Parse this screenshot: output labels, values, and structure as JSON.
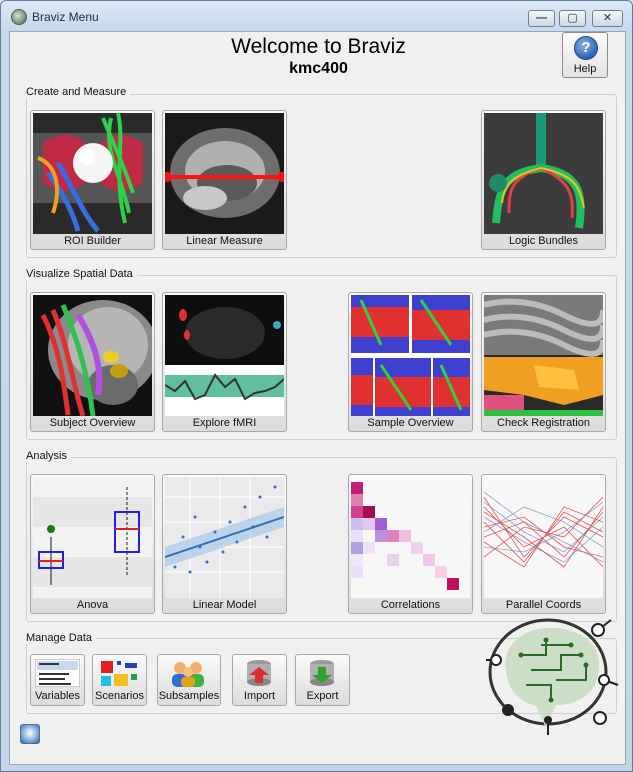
{
  "window": {
    "title": "Braviz Menu",
    "min_glyph": "—",
    "max_glyph": "▢",
    "close_glyph": "✕"
  },
  "header": {
    "welcome": "Welcome to Braviz",
    "user": "kmc400"
  },
  "help": {
    "icon_glyph": "?",
    "label": "Help"
  },
  "sections": {
    "create": {
      "title": "Create and Measure",
      "tiles": {
        "roi": "ROI Builder",
        "linear": "Linear Measure",
        "logic": "Logic Bundles"
      }
    },
    "visualize": {
      "title": "Visualize Spatial Data",
      "tiles": {
        "subject": "Subject Overview",
        "fmri": "Explore fMRI",
        "sample": "Sample Overview",
        "registration": "Check Registration"
      }
    },
    "analysis": {
      "title": "Analysis",
      "tiles": {
        "anova": "Anova",
        "linear_model": "Linear Model",
        "correlations": "Correlations",
        "parallel": "Parallel Coords"
      }
    },
    "manage": {
      "title": "Manage Data",
      "buttons": {
        "variables": "Variables",
        "scenarios": "Scenarios",
        "subsamples": "Subsamples",
        "import": "Import",
        "export": "Export"
      }
    }
  },
  "colors": {
    "title_bar": "#c7d9ee",
    "panel": "#f0f0f0",
    "accent_red": "#e01010",
    "accent_blue": "#2d64b3"
  }
}
